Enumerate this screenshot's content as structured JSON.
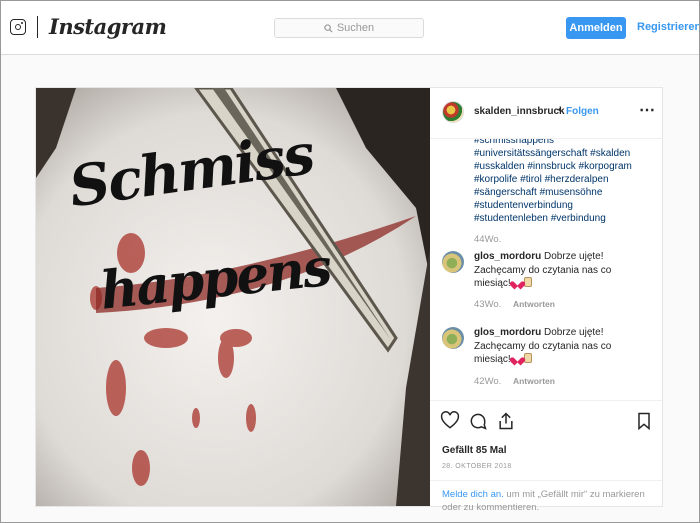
{
  "app": {
    "logo_text": "Instagram"
  },
  "header": {
    "search_placeholder": "Suchen",
    "login_label": "Anmelden",
    "register_label": "Registrieren"
  },
  "post": {
    "username": "skalden_innsbruck",
    "separator": "•",
    "follow_label": "Folgen",
    "hashtags": [
      "#schmisshappens",
      "#universitätssängerschaft #skalden",
      "#usskalden #innsbruck #korpogram",
      "#korpolife #tirol #herzderalpen",
      "#sängerschaft #musensöhne",
      "#studentenverbindung",
      "#studentenleben #verbindung"
    ],
    "caption_age": "44Wo.",
    "comments": [
      {
        "user": "glos_mordoru",
        "text_line1": "Dobrze ujęte!",
        "text_line2": "Zachęcamy do czytania nas co",
        "text_line3": "miesiąc!",
        "age": "43Wo.",
        "reply": "Antworten"
      },
      {
        "user": "glos_mordoru",
        "text_line1": "Dobrze ujęte!",
        "text_line2": "Zachęcamy do czytania nas co",
        "text_line3": "miesiąc!",
        "age": "42Wo.",
        "reply": "Antworten"
      }
    ],
    "likes": "Gefällt 85 Mal",
    "date": "28. OKTOBER 2018",
    "login_prompt_link": "Melde dich an.",
    "login_prompt_text": " um mit „Gefällt mir“ zu markieren oder zu kommentieren.",
    "shirt_text_line1": "Schmiss",
    "shirt_text_line2": "happens"
  },
  "colors": {
    "accent": "#3897f0",
    "text": "#262626",
    "muted": "#999999",
    "hashtag": "#003569"
  }
}
